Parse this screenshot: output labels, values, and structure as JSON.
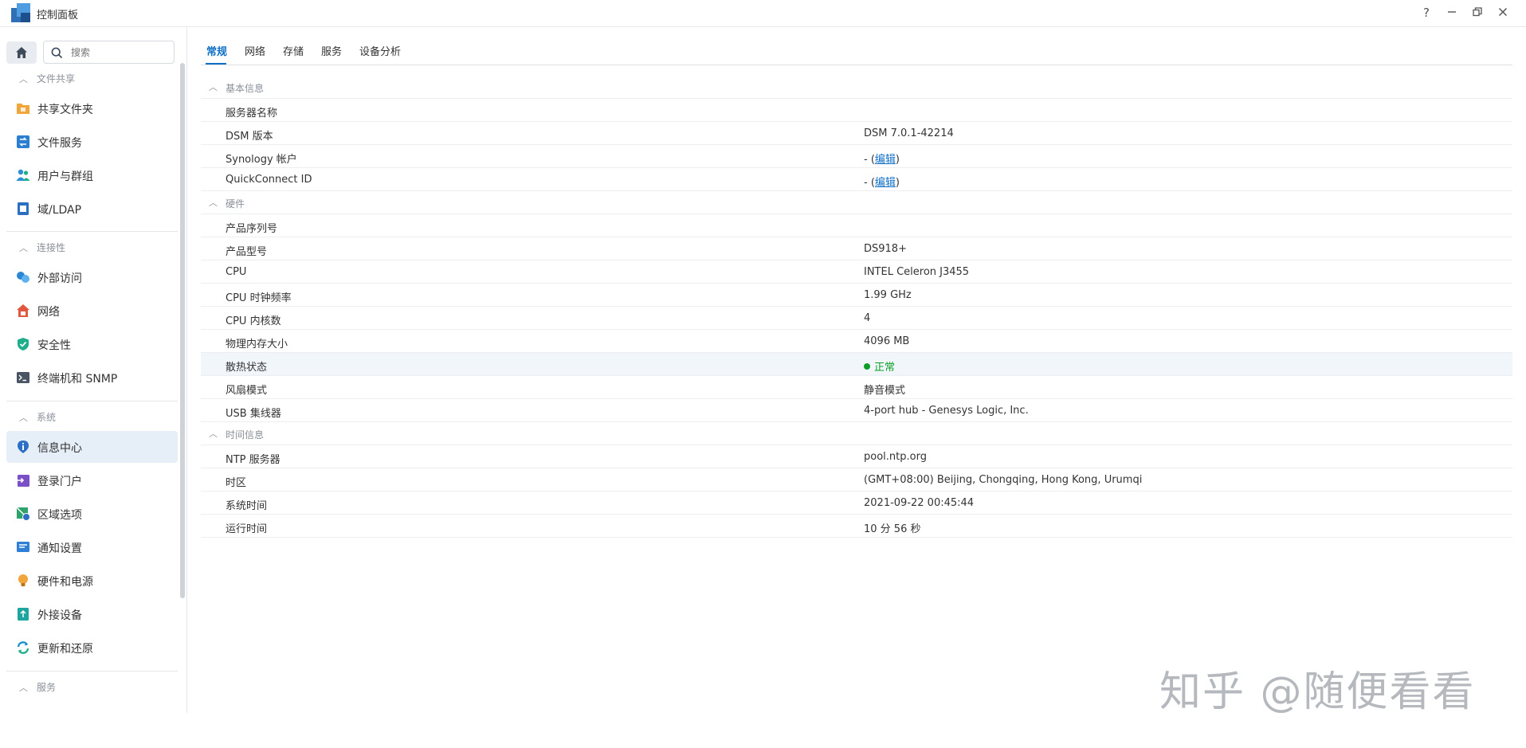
{
  "window": {
    "title": "控制面板",
    "help": "?",
    "minimize": "–",
    "restore": "❐",
    "close": "✕"
  },
  "sidebar": {
    "search_placeholder": "搜索",
    "sections": [
      {
        "title": "文件共享",
        "items": [
          {
            "label": "共享文件夹",
            "icon": "shared-folder-icon",
            "color": "#f0a63a"
          },
          {
            "label": "文件服务",
            "icon": "file-services-icon",
            "color": "#2a7fd1"
          },
          {
            "label": "用户与群组",
            "icon": "user-group-icon",
            "color": "#2e8fd8"
          },
          {
            "label": "域/LDAP",
            "icon": "domain-ldap-icon",
            "color": "#2a6fc2"
          }
        ]
      },
      {
        "title": "连接性",
        "items": [
          {
            "label": "外部访问",
            "icon": "external-access-icon",
            "color": "#2b86d6"
          },
          {
            "label": "网络",
            "icon": "network-icon",
            "color": "#e0573f"
          },
          {
            "label": "安全性",
            "icon": "security-shield-icon",
            "color": "#1fae8b"
          },
          {
            "label": "终端机和 SNMP",
            "icon": "terminal-snmp-icon",
            "color": "#4a5563"
          }
        ]
      },
      {
        "title": "系统",
        "items": [
          {
            "label": "信息中心",
            "icon": "info-center-icon",
            "color": "#2b6fc7",
            "active": true
          },
          {
            "label": "登录门户",
            "icon": "login-portal-icon",
            "color": "#7b4fc5"
          },
          {
            "label": "区域选项",
            "icon": "regional-options-icon",
            "color": "#2fa36b"
          },
          {
            "label": "通知设置",
            "icon": "notification-icon",
            "color": "#2f7fd6"
          },
          {
            "label": "硬件和电源",
            "icon": "hardware-power-icon",
            "color": "#f0a63a"
          },
          {
            "label": "外接设备",
            "icon": "external-devices-icon",
            "color": "#1fa5a0"
          },
          {
            "label": "更新和还原",
            "icon": "update-restore-icon",
            "color": "#1c8fd0"
          }
        ]
      },
      {
        "title": "服务",
        "items": []
      }
    ]
  },
  "tabs": [
    "常规",
    "网络",
    "存储",
    "服务",
    "设备分析"
  ],
  "info": {
    "groups": [
      {
        "title": "基本信息",
        "rows": [
          {
            "key": "服务器名称",
            "value": ""
          },
          {
            "key": "DSM 版本",
            "value": "DSM 7.0.1-42214"
          },
          {
            "key": "Synology 帐户",
            "value": "- (",
            "link": "编辑",
            "suffix": ")"
          },
          {
            "key": "QuickConnect ID",
            "value": "- (",
            "link": "编辑",
            "suffix": ")"
          }
        ]
      },
      {
        "title": "硬件",
        "rows": [
          {
            "key": "产品序列号",
            "value": ""
          },
          {
            "key": "产品型号",
            "value": "DS918+"
          },
          {
            "key": "CPU",
            "value": "INTEL Celeron J3455"
          },
          {
            "key": "CPU 时钟频率",
            "value": "1.99 GHz"
          },
          {
            "key": "CPU 内核数",
            "value": "4"
          },
          {
            "key": "物理内存大小",
            "value": "4096 MB"
          },
          {
            "key": "散热状态",
            "value": "正常",
            "status": "ok"
          },
          {
            "key": "风扇模式",
            "value": "静音模式"
          },
          {
            "key": "USB 集线器",
            "value": "4-port hub - Genesys Logic, Inc."
          }
        ]
      },
      {
        "title": "时间信息",
        "rows": [
          {
            "key": "NTP 服务器",
            "value": "pool.ntp.org"
          },
          {
            "key": "时区",
            "value": "(GMT+08:00) Beijing, Chongqing, Hong Kong, Urumqi"
          },
          {
            "key": "系统时间",
            "value": "2021-09-22 00:45:44"
          },
          {
            "key": "运行时间",
            "value": "10 分 56 秒"
          }
        ]
      }
    ]
  },
  "watermark": "知乎 @随便看看",
  "colors": {
    "accent": "#0f6fc5",
    "status_ok": "#0d9e27",
    "active_item_bg": "#e6eef8"
  }
}
